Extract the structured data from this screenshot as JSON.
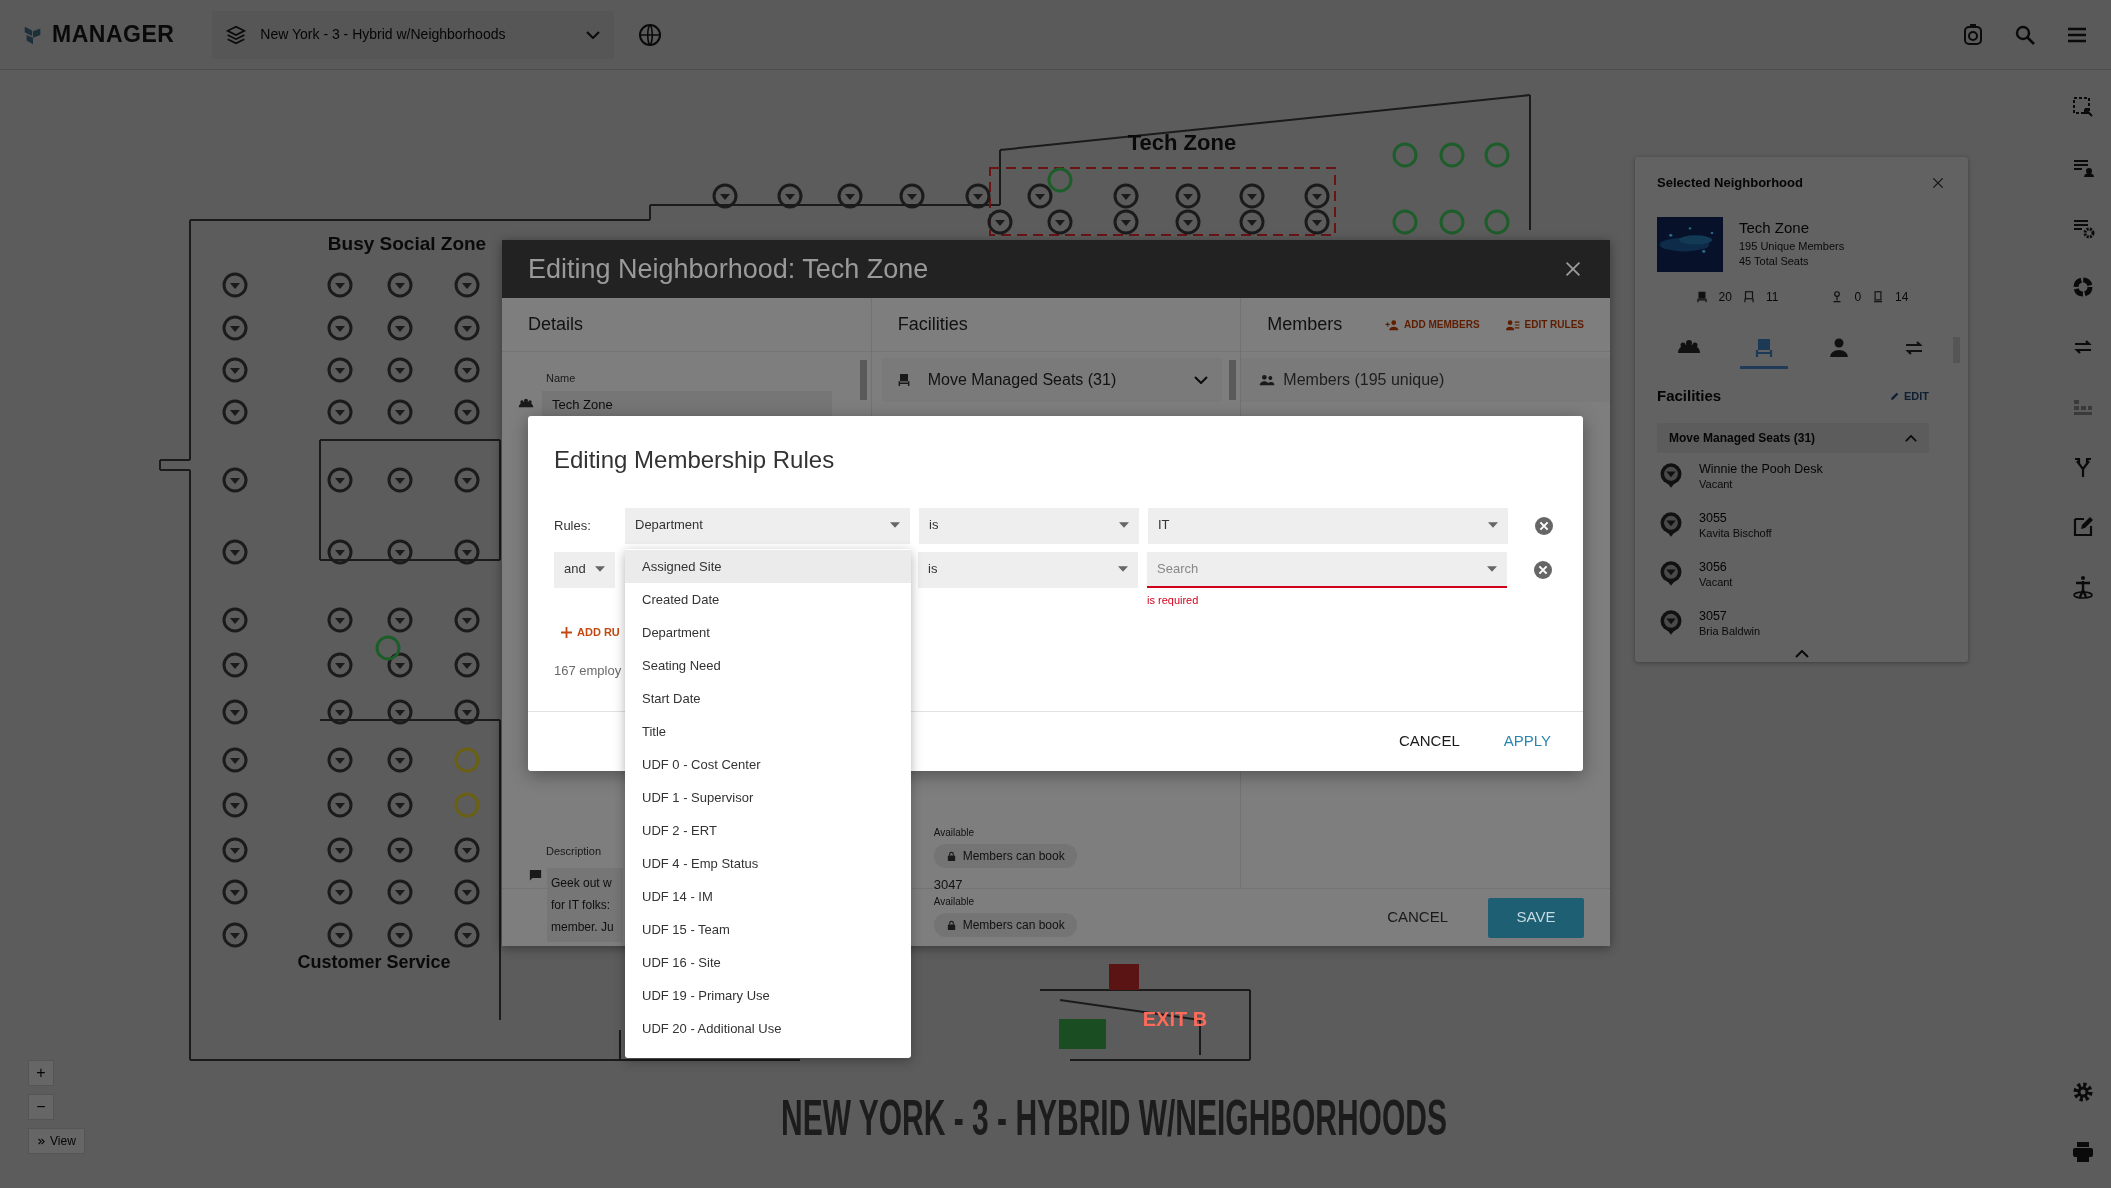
{
  "top_bar": {
    "logo": "MANAGER",
    "site": "New York - 3 - Hybrid w/Neighborhoods"
  },
  "floor_plan": {
    "zones": [
      "Tech Zone",
      "Busy Social Zone",
      "Customer Service"
    ],
    "exit_label": "EXIT B",
    "title": "NEW YORK - 3 - HYBRID W/NEIGHBORHOODS"
  },
  "map_controls": {
    "zoom_in": "+",
    "zoom_out": "−",
    "view": "View"
  },
  "selected_neighborhood": {
    "title": "Selected Neighborhood",
    "name": "Tech Zone",
    "members": "195 Unique Members",
    "seats": "45 Total Seats",
    "stats": [
      "20",
      "11",
      "0",
      "14"
    ],
    "tabs": [
      {
        "selected": false
      },
      {
        "selected": true
      },
      {
        "selected": false
      },
      {
        "selected": false
      }
    ],
    "section": "Facilities",
    "edit": "EDIT",
    "group": {
      "label": "Move Managed Seats (31)",
      "expanded": true
    },
    "items": [
      {
        "name": "Winnie the Pooh Desk",
        "sub": "Vacant"
      },
      {
        "name": "3055",
        "sub": "Kavita Bischoff"
      },
      {
        "name": "3056",
        "sub": "Vacant"
      },
      {
        "name": "3057",
        "sub": "Bria Baldwin"
      }
    ]
  },
  "neighborhood_dialog": {
    "title": "Editing Neighborhood: Tech Zone",
    "details": {
      "heading": "Details",
      "name_label": "Name",
      "name_value": "Tech Zone",
      "description_label": "Description",
      "description_lines": [
        "Geek out w",
        "for IT folks:",
        "member. Ju"
      ]
    },
    "facilities": {
      "heading": "Facilities",
      "group": {
        "label": "Move Managed Seats (31)",
        "expanded": false
      },
      "items": [
        {
          "status": "Available",
          "chip": "Members can book"
        },
        {
          "name": "3047",
          "status": "Available",
          "chip": "Members can book"
        }
      ]
    },
    "members": {
      "heading": "Members",
      "add": "ADD MEMBERS",
      "edit": "EDIT RULES",
      "summary": "Members (195 unique)"
    },
    "cancel": "CANCEL",
    "save": "SAVE"
  },
  "rules_dialog": {
    "title": "Editing Membership Rules",
    "rules_label": "Rules:",
    "rows": [
      {
        "field": "Department",
        "operator": "is",
        "value": "IT",
        "invalid": false
      },
      {
        "joiner": "and",
        "operator": "is",
        "placeholder": "Search",
        "invalid": true,
        "error": "is required"
      }
    ],
    "add_rule": "ADD RU",
    "count": "167 employ",
    "cancel": "CANCEL",
    "apply": "APPLY"
  },
  "field_menu": [
    {
      "label": "Assigned Site",
      "selected": true
    },
    {
      "label": "Created Date",
      "selected": false
    },
    {
      "label": "Department",
      "selected": false
    },
    {
      "label": "Seating Need",
      "selected": false
    },
    {
      "label": "Start Date",
      "selected": false
    },
    {
      "label": "Title",
      "selected": false
    },
    {
      "label": "UDF 0 - Cost Center",
      "selected": false
    },
    {
      "label": "UDF 1 - Supervisor",
      "selected": false
    },
    {
      "label": "UDF 2 - ERT",
      "selected": false
    },
    {
      "label": "UDF 4 - Emp Status",
      "selected": false
    },
    {
      "label": "UDF 14 - IM",
      "selected": false
    },
    {
      "label": "UDF 15 - Team",
      "selected": false
    },
    {
      "label": "UDF 16 - Site",
      "selected": false
    },
    {
      "label": "UDF 19 - Primary Use",
      "selected": false
    },
    {
      "label": "UDF 20 - Additional Use",
      "selected": false
    }
  ]
}
